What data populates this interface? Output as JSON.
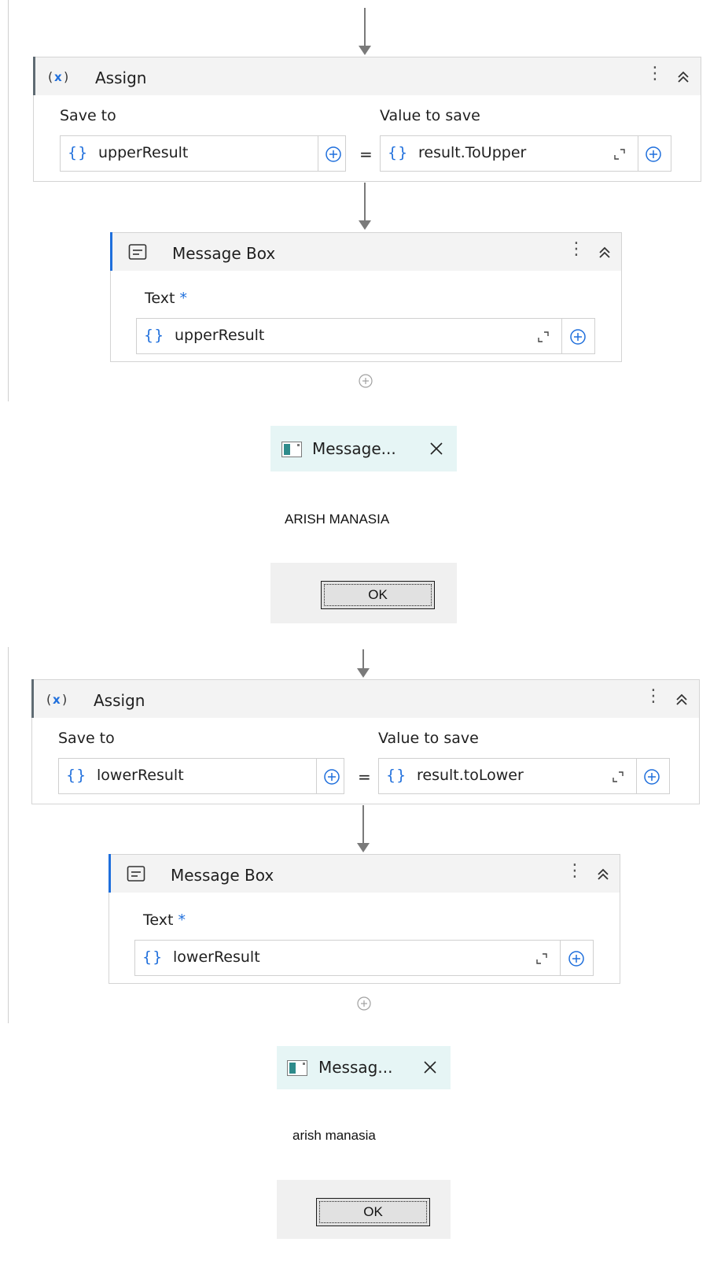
{
  "blocks": [
    {
      "assign": {
        "title": "Assign",
        "save_to_label": "Save to",
        "value_label": "Value to save",
        "save_to_value": "upperResult",
        "value_value": "result.ToUpper",
        "equals": "="
      },
      "message_box": {
        "title": "Message Box",
        "text_label": "Text",
        "required_mark": "*",
        "text_value": "upperResult"
      },
      "dialog": {
        "title": "Message...",
        "message": "ARISH MANASIA",
        "ok_label": "OK"
      }
    },
    {
      "assign": {
        "title": "Assign",
        "save_to_label": "Save to",
        "value_label": "Value to save",
        "save_to_value": "lowerResult",
        "value_value": "result.toLower",
        "equals": "="
      },
      "message_box": {
        "title": "Message Box",
        "text_label": "Text",
        "required_mark": "*",
        "text_value": "lowerResult"
      },
      "dialog": {
        "title": "Messag...",
        "message": "arish manasia",
        "ok_label": "OK"
      }
    }
  ],
  "icons": {
    "variable": "variable-x-icon",
    "expression": "curly-braces-icon",
    "add": "plus-circle-icon",
    "expand": "expand-corner-icon",
    "menu": "kebab-menu-icon",
    "collapse": "chevron-double-up-icon",
    "message": "message-box-icon",
    "window": "window-icon",
    "close": "close-icon"
  },
  "colors": {
    "accent_blue": "#1f6fdc",
    "assign_accent": "#5f6b73",
    "dialog_title_bg": "#e6f5f5"
  }
}
